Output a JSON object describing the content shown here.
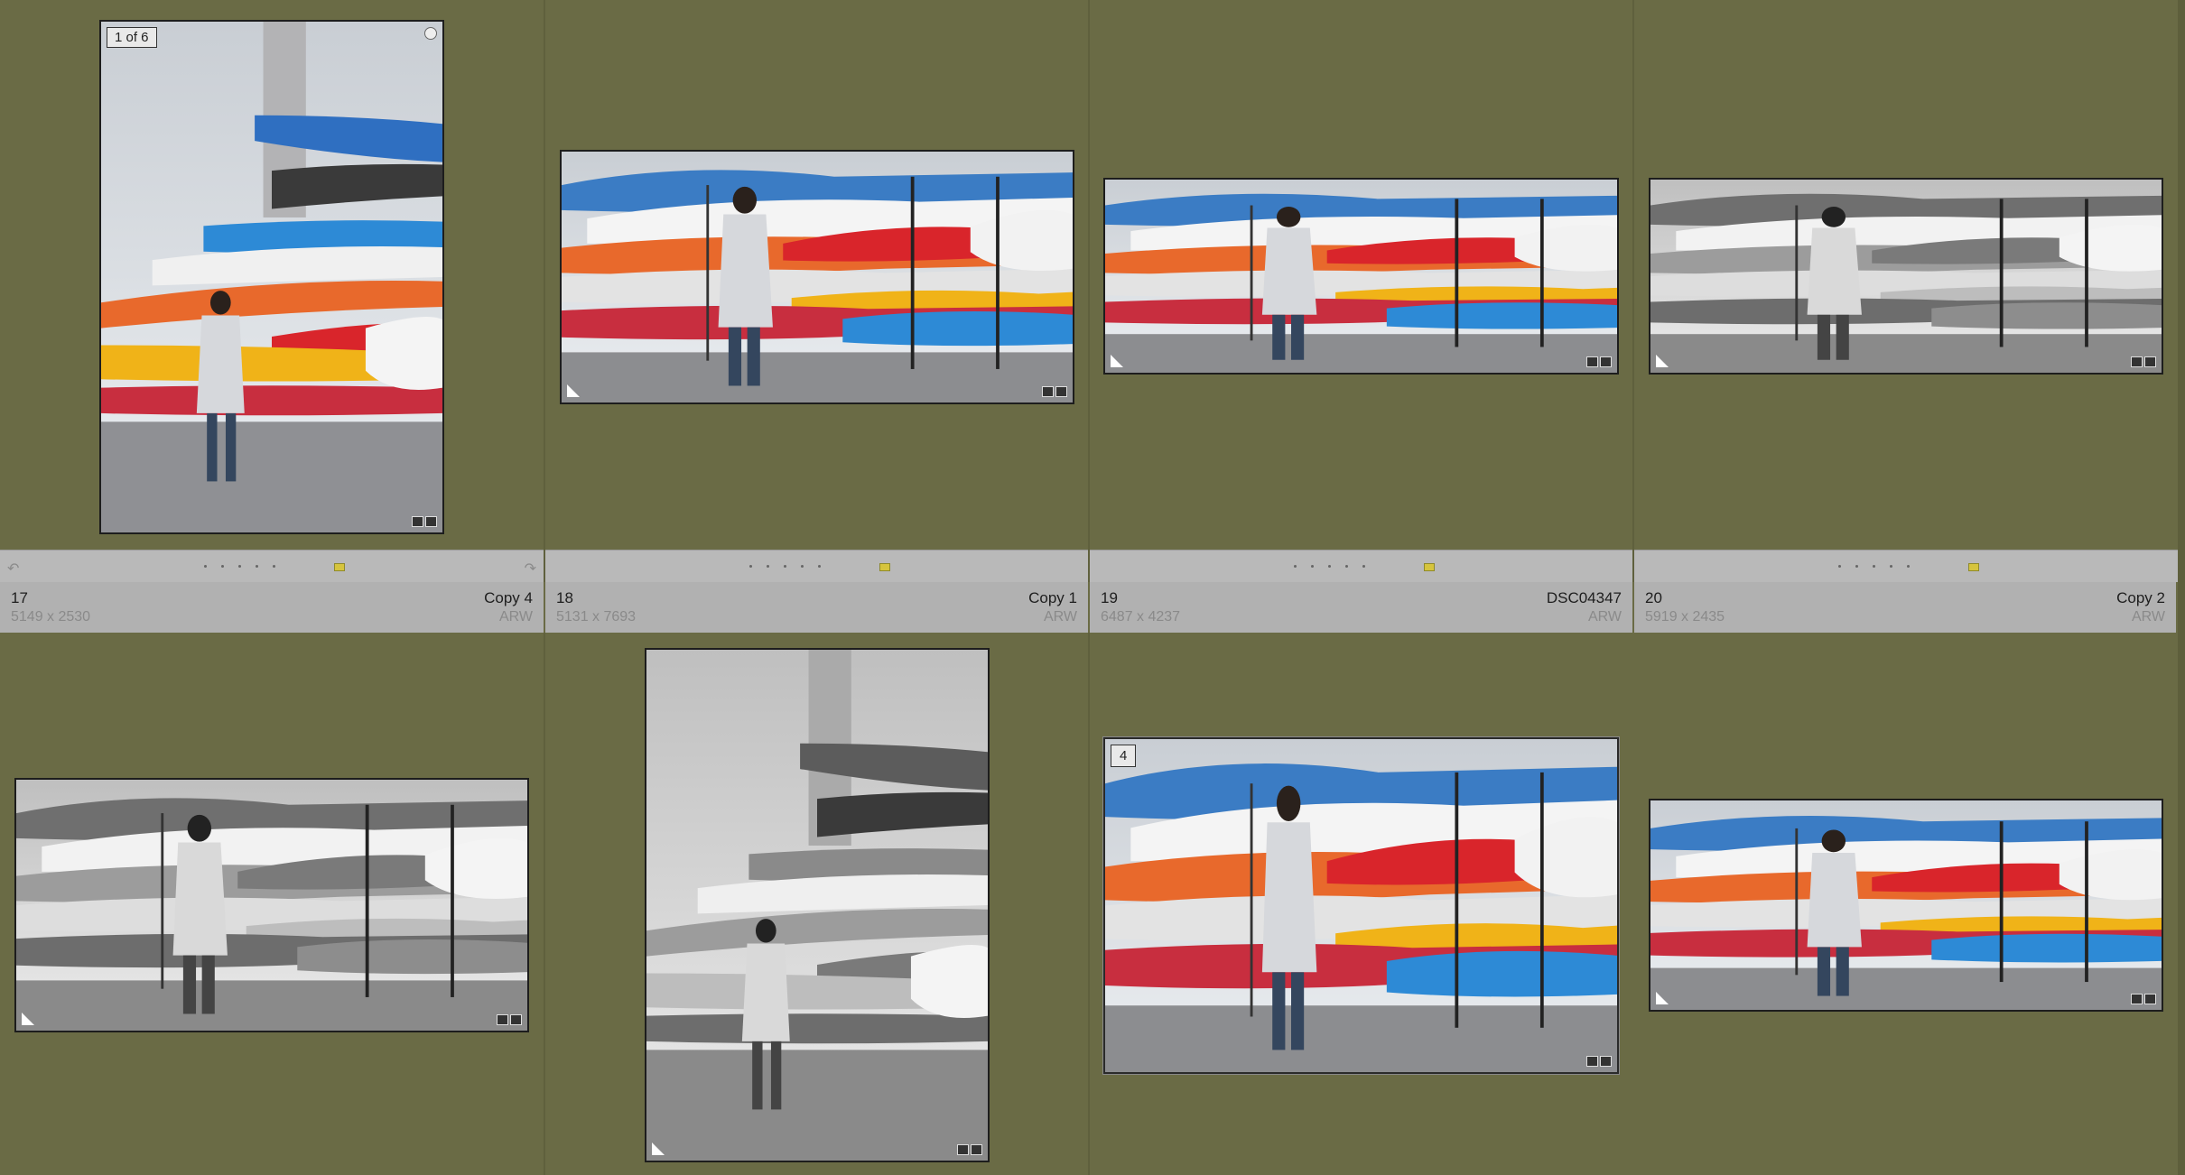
{
  "grid": {
    "top_row": [
      {
        "index": "17",
        "name": "Copy 4",
        "dimensions": "5149 x 2530",
        "format": "ARW",
        "stack_label": "1 of 6"
      },
      {
        "index": "18",
        "name": "Copy 1",
        "dimensions": "5131 x 7693",
        "format": "ARW"
      },
      {
        "index": "19",
        "name": "DSC04347",
        "dimensions": "6487 x 4237",
        "format": "ARW"
      },
      {
        "index": "20",
        "name": "Copy 2",
        "dimensions": "5919 x 2435",
        "format": "ARW"
      }
    ],
    "bottom_row": [
      {
        "selected_number": "4"
      }
    ]
  },
  "icons": [
    "rotate-left-icon",
    "rotate-right-icon",
    "badge-corner-icon",
    "edit-badge-icon",
    "pick-flag-icon"
  ],
  "colors": {
    "background": "#6a6b45",
    "info_bar": "#b1b1b1",
    "rating_bar": "#b9b9b9",
    "color_label": "#d6c43d"
  }
}
